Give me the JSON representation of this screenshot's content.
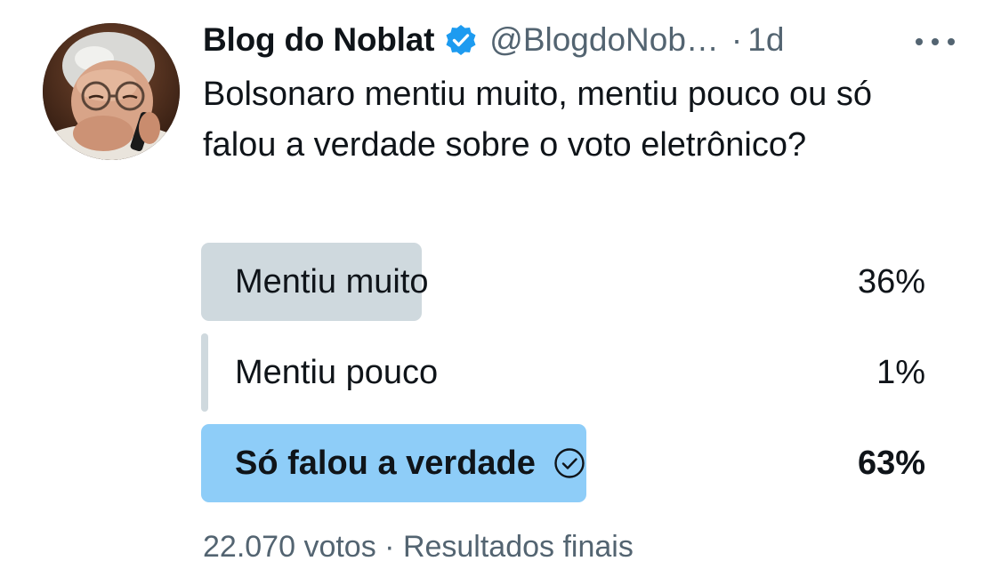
{
  "tweet": {
    "author": {
      "display_name": "Blog do Noblat",
      "handle": "@BlogdoNob…",
      "verified": true,
      "avatar_icon": "person-on-phone-avatar"
    },
    "separator": "·",
    "timestamp": "1d",
    "more_icon": "more-horizontal-icon",
    "text": "Bolsonaro mentiu muito, mentiu pouco ou só falou a verdade sobre o voto eletrônico?",
    "poll": {
      "options": [
        {
          "label": "Mentiu muito",
          "percent_label": "36%",
          "percent": 36,
          "winner": false
        },
        {
          "label": "Mentiu pouco",
          "percent_label": "1%",
          "percent": 1,
          "winner": false
        },
        {
          "label": "Só falou a verdade",
          "percent_label": "63%",
          "percent": 63,
          "winner": true
        }
      ],
      "votes": "22.070 votos",
      "footer_separator": "·",
      "status": "Resultados finais"
    }
  },
  "colors": {
    "bar_default": "#cfd9de",
    "bar_winner": "#8ecdf8",
    "verified_badge": "#1d9bf0",
    "secondary_text": "#536471",
    "primary_text": "#0f1419"
  }
}
